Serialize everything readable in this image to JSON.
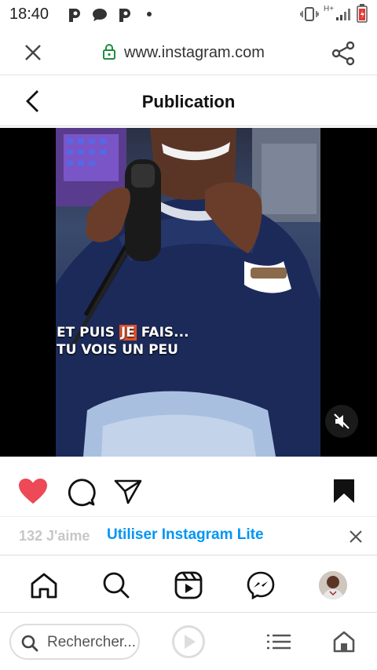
{
  "status_bar": {
    "time": "18:40",
    "notifications": [
      "p-app-icon",
      "chat-bubble-icon",
      "p-app-icon",
      "dot-icon"
    ],
    "network": "H+",
    "indicators": [
      "vibrate-icon",
      "signal-icon",
      "battery-icon"
    ]
  },
  "browser": {
    "url": "www.instagram.com",
    "close_icon": "close-icon",
    "lock_icon": "lock-icon",
    "share_icon": "share-icon"
  },
  "header": {
    "title": "Publication",
    "back_icon": "chevron-left-icon"
  },
  "post": {
    "caption_before": "ET PUIS ",
    "caption_highlight": "JE",
    "caption_after": " FAIS...",
    "caption_line2": "TU VOIS UN PEU",
    "mute_icon": "speaker-muted-icon",
    "liked": true
  },
  "banner": {
    "likes_text": "132 J'aime",
    "lite_label": "Utiliser Instagram Lite",
    "close_icon": "close-icon"
  },
  "ig_nav": {
    "items": [
      "home-icon",
      "search-icon",
      "reels-icon",
      "messenger-icon",
      "profile-avatar"
    ]
  },
  "browser_bottom": {
    "search_placeholder": "Rechercher...",
    "items": [
      "play-icon",
      "menu-icon",
      "home-icon"
    ]
  },
  "colors": {
    "heart": "#ed4956",
    "link_blue": "#0095f6",
    "lock_green": "#1e8e3e",
    "caption_highlight": "#e0502a"
  }
}
